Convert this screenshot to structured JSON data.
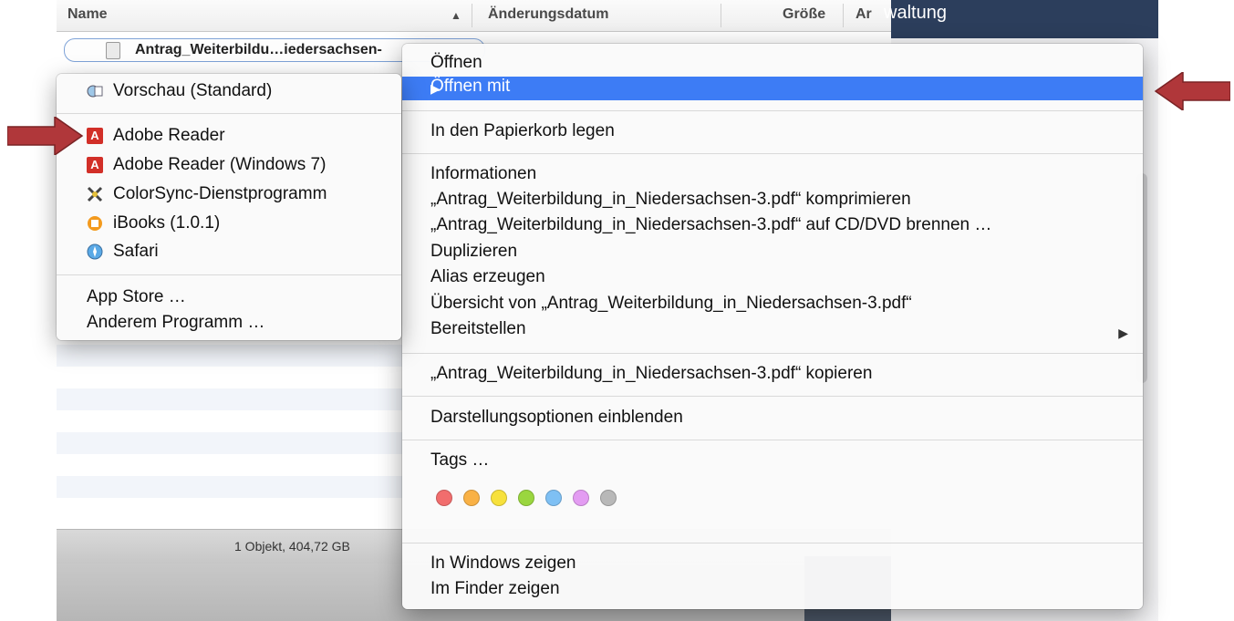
{
  "finder": {
    "col_name": "Name",
    "col_sort_indicator": "▲",
    "col_date": "Änderungsdatum",
    "col_size": "Größe",
    "col_kind_partial": "Ar",
    "file_name": "Antrag_Weiterbildu…iedersachsen-",
    "status": "1 Objekt, 404,72 GB"
  },
  "bg_window": {
    "title_partial": "waltung"
  },
  "context_menu": {
    "open": "Öffnen",
    "open_with": "Öffnen mit",
    "trash": "In den Papierkorb legen",
    "info": "Informationen",
    "compress": "„Antrag_Weiterbildung_in_Niedersachsen-3.pdf“ komprimieren",
    "burn": "„Antrag_Weiterbildung_in_Niedersachsen-3.pdf“ auf CD/DVD brennen …",
    "duplicate": "Duplizieren",
    "alias": "Alias erzeugen",
    "quicklook": "Übersicht von „Antrag_Weiterbildung_in_Niedersachsen-3.pdf“",
    "share": "Bereitstellen",
    "copy": "„Antrag_Weiterbildung_in_Niedersachsen-3.pdf“ kopieren",
    "view_options": "Darstellungsoptionen einblenden",
    "tags": "Tags …",
    "tag_colors": [
      "#f16d6d",
      "#f9b145",
      "#f7e13c",
      "#9ad63f",
      "#7ec0f4",
      "#e39cf2",
      "#b8b8b8"
    ],
    "show_in_windows": "In Windows zeigen",
    "show_in_finder": "Im Finder zeigen",
    "submenu_arrow": "▶"
  },
  "open_with_menu": {
    "preview": "Vorschau (Standard)",
    "adobe_reader": "Adobe Reader",
    "adobe_reader_win7": "Adobe Reader (Windows 7)",
    "colorsync": "ColorSync-Dienstprogramm",
    "ibooks": "iBooks (1.0.1)",
    "safari": "Safari",
    "app_store": "App Store …",
    "other": "Anderem Programm …"
  },
  "annotation_color": "#b0373a"
}
